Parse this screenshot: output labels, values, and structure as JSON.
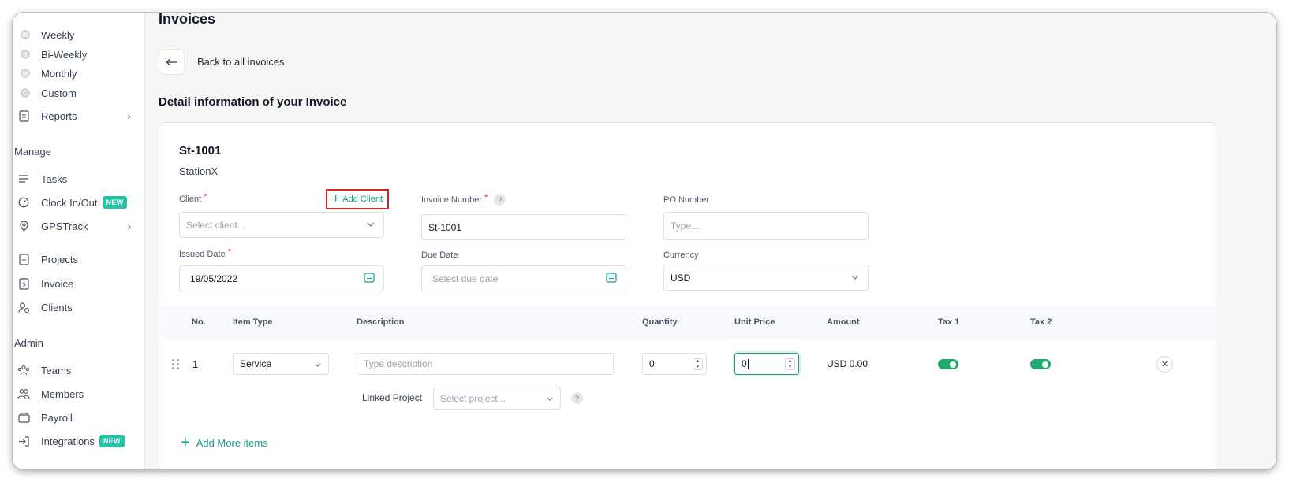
{
  "sidebar": {
    "sub_items": [
      {
        "badge": "W",
        "label": "Weekly"
      },
      {
        "badge": "B",
        "label": "Bi-Weekly"
      },
      {
        "badge": "M",
        "label": "Monthly"
      },
      {
        "badge": "C",
        "label": "Custom"
      }
    ],
    "reports_label": "Reports",
    "manage_heading": "Manage",
    "manage_items": [
      {
        "label": "Tasks",
        "icon": "list-icon"
      },
      {
        "label": "Clock In/Out",
        "icon": "clock-icon",
        "badge": "NEW"
      },
      {
        "label": "GPSTrack",
        "icon": "map-pin-icon"
      }
    ],
    "project_items": [
      {
        "label": "Projects",
        "icon": "folder-icon"
      },
      {
        "label": "Invoice",
        "icon": "invoice-icon"
      },
      {
        "label": "Clients",
        "icon": "client-icon"
      }
    ],
    "admin_heading": "Admin",
    "admin_items": [
      {
        "label": "Teams",
        "icon": "teams-icon"
      },
      {
        "label": "Members",
        "icon": "members-icon"
      },
      {
        "label": "Payroll",
        "icon": "payroll-icon"
      },
      {
        "label": "Integrations",
        "icon": "integrations-icon",
        "badge": "NEW"
      }
    ]
  },
  "header": {
    "page_title": "Invoices",
    "back_label": "Back to all invoices",
    "section_title": "Detail information of your Invoice"
  },
  "invoice": {
    "number_heading": "St-1001",
    "company": "StationX",
    "client": {
      "label": "Client",
      "placeholder": "Select client...",
      "add_label": "Add Client"
    },
    "invoice_number": {
      "label": "Invoice Number",
      "value": "St-1001"
    },
    "po_number": {
      "label": "PO Number",
      "placeholder": "Type..."
    },
    "issued_date": {
      "label": "Issued Date",
      "value": "19/05/2022"
    },
    "due_date": {
      "label": "Due Date",
      "placeholder": "Select due date"
    },
    "currency": {
      "label": "Currency",
      "value": "USD"
    }
  },
  "table": {
    "headers": [
      "No.",
      "Item Type",
      "Description",
      "Quantity",
      "Unit Price",
      "Amount",
      "Tax 1",
      "Tax 2"
    ],
    "rows": [
      {
        "no": "1",
        "item_type": "Service",
        "description_placeholder": "Type description",
        "quantity": "0",
        "unit_price": "0",
        "amount": "USD 0.00",
        "tax1": true,
        "tax2": true,
        "linked_project_label": "Linked Project",
        "linked_project_placeholder": "Select project..."
      }
    ],
    "add_more_label": "Add More items"
  },
  "colors": {
    "accent": "#16a085",
    "toggle_on": "#22a86f",
    "highlight_border": "#dc2626",
    "new_badge": "#22c3a6"
  }
}
